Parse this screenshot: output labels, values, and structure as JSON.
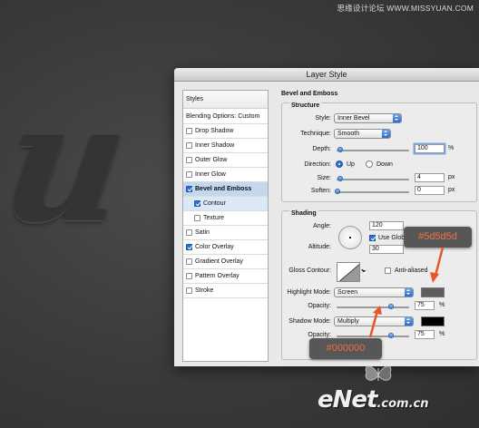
{
  "watermark_top": "思缘设计论坛 WWW.MISSYUAN.COM",
  "background_letter": "u",
  "dialog": {
    "title": "Layer Style",
    "sidebar": {
      "header": "Styles",
      "blending": "Blending Options: Custom",
      "items": [
        {
          "label": "Drop Shadow",
          "checked": false
        },
        {
          "label": "Inner Shadow",
          "checked": false
        },
        {
          "label": "Outer Glow",
          "checked": false
        },
        {
          "label": "Inner Glow",
          "checked": false
        },
        {
          "label": "Bevel and Emboss",
          "checked": true
        },
        {
          "label": "Contour",
          "checked": true
        },
        {
          "label": "Texture",
          "checked": false
        },
        {
          "label": "Satin",
          "checked": false
        },
        {
          "label": "Color Overlay",
          "checked": true
        },
        {
          "label": "Gradient Overlay",
          "checked": false
        },
        {
          "label": "Pattern Overlay",
          "checked": false
        },
        {
          "label": "Stroke",
          "checked": false
        }
      ]
    },
    "bevel": {
      "title": "Bevel and Emboss",
      "structure": {
        "title": "Structure",
        "style_label": "Style:",
        "style_value": "Inner Bevel",
        "technique_label": "Technique:",
        "technique_value": "Smooth",
        "depth_label": "Depth:",
        "depth_value": "100",
        "depth_unit": "%",
        "direction_label": "Direction:",
        "direction_up": "Up",
        "direction_down": "Down",
        "size_label": "Size:",
        "size_value": "4",
        "size_unit": "px",
        "soften_label": "Soften:",
        "soften_value": "0",
        "soften_unit": "px"
      },
      "shading": {
        "title": "Shading",
        "angle_label": "Angle:",
        "angle_value": "120",
        "use_global_label": "Use Global",
        "altitude_label": "Altitude:",
        "altitude_value": "30",
        "gloss_contour_label": "Gloss Contour:",
        "anti_aliased_label": "Anti-aliased",
        "highlight_mode_label": "Highlight Mode:",
        "highlight_mode_value": "Screen",
        "highlight_color": "#5d5d5d",
        "highlight_opacity_label": "Opacity:",
        "highlight_opacity_value": "75",
        "highlight_opacity_unit": "%",
        "shadow_mode_label": "Shadow Mode:",
        "shadow_mode_value": "Multiply",
        "shadow_color": "#000000",
        "shadow_opacity_label": "Opacity:",
        "shadow_opacity_value": "75",
        "shadow_opacity_unit": "%"
      }
    }
  },
  "callouts": {
    "highlight": "#5d5d5d",
    "shadow": "#000000"
  },
  "logo": {
    "main": "eNet",
    "small": ".com.cn"
  },
  "colors": {
    "accent": "#2f6fd0",
    "callout_text": "#f07040",
    "arrow": "#e8552a"
  }
}
